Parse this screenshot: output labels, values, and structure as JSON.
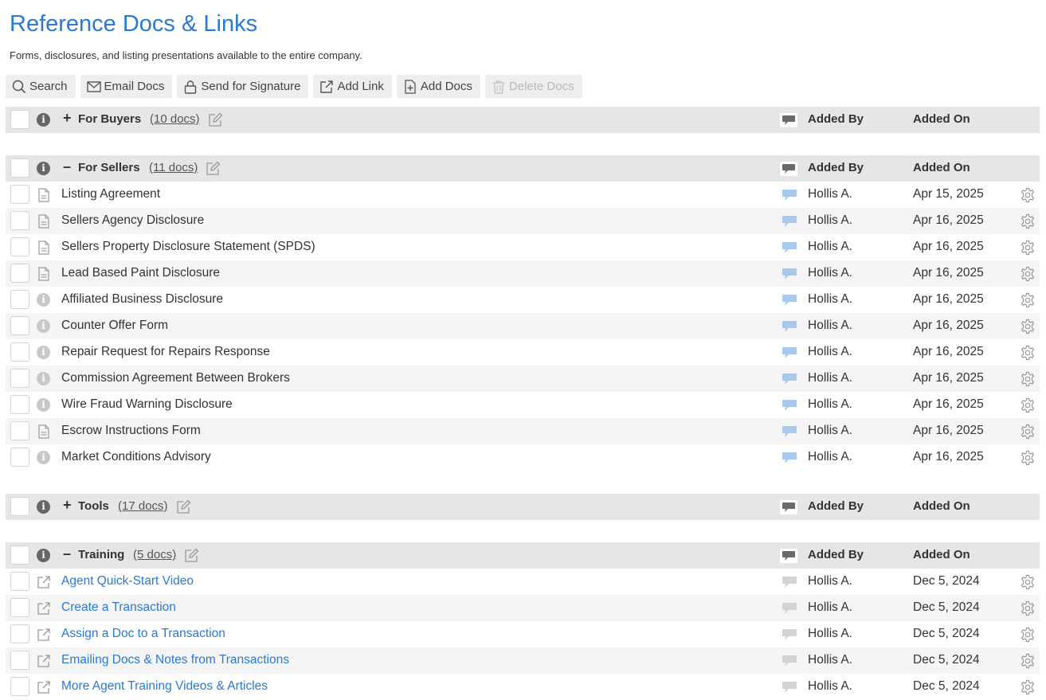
{
  "page": {
    "title": "Reference Docs & Links",
    "subtitle": "Forms, disclosures, and listing presentations available to the entire company."
  },
  "toolbar": {
    "search": "Search",
    "email_docs": "Email Docs",
    "send_for_signature": "Send for Signature",
    "add_link": "Add Link",
    "add_docs": "Add Docs",
    "delete_docs": "Delete Docs"
  },
  "columns": {
    "added_by": "Added By",
    "added_on": "Added On"
  },
  "colors": {
    "accent": "#2a7ad1",
    "comment_active": "#a7c9ec",
    "comment_inactive": "#d3d3d3",
    "header_bg": "#e6e6e6"
  },
  "groups": [
    {
      "toggle": "+",
      "name": "For Buyers",
      "count": "(10 docs)",
      "expanded": false,
      "items": []
    },
    {
      "toggle": "–",
      "name": "For Sellers",
      "count": "(11 docs)",
      "expanded": true,
      "items": [
        {
          "name": "Listing Agreement",
          "icon": "document-icon",
          "added_by": "Hollis A.",
          "added_on": "Apr 15, 2025"
        },
        {
          "name": "Sellers Agency Disclosure",
          "icon": "document-icon",
          "added_by": "Hollis A.",
          "added_on": "Apr 16, 2025"
        },
        {
          "name": "Sellers Property Disclosure Statement (SPDS)",
          "icon": "document-icon",
          "added_by": "Hollis A.",
          "added_on": "Apr 16, 2025"
        },
        {
          "name": "Lead Based Paint Disclosure",
          "icon": "document-icon",
          "added_by": "Hollis A.",
          "added_on": "Apr 16, 2025"
        },
        {
          "name": "Affiliated Business Disclosure",
          "icon": "info-icon",
          "added_by": "Hollis A.",
          "added_on": "Apr 16, 2025"
        },
        {
          "name": "Counter Offer Form",
          "icon": "info-icon",
          "added_by": "Hollis A.",
          "added_on": "Apr 16, 2025"
        },
        {
          "name": "Repair Request for Repairs Response",
          "icon": "info-icon",
          "added_by": "Hollis A.",
          "added_on": "Apr 16, 2025"
        },
        {
          "name": "Commission Agreement Between Brokers",
          "icon": "info-icon",
          "added_by": "Hollis A.",
          "added_on": "Apr 16, 2025"
        },
        {
          "name": "Wire Fraud Warning Disclosure",
          "icon": "info-icon",
          "added_by": "Hollis A.",
          "added_on": "Apr 16, 2025"
        },
        {
          "name": "Escrow Instructions Form",
          "icon": "document-icon",
          "added_by": "Hollis A.",
          "added_on": "Apr 16, 2025"
        },
        {
          "name": "Market Conditions Advisory",
          "icon": "info-icon",
          "added_by": "Hollis A.",
          "added_on": "Apr 16, 2025"
        }
      ]
    },
    {
      "toggle": "+",
      "name": "Tools",
      "count": "(17 docs)",
      "expanded": false,
      "items": []
    },
    {
      "toggle": "–",
      "name": "Training",
      "count": "(5 docs)",
      "expanded": true,
      "items": [
        {
          "name": "Agent Quick-Start Video",
          "icon": "external-link-icon",
          "added_by": "Hollis A.",
          "added_on": "Dec 5, 2024"
        },
        {
          "name": "Create a Transaction",
          "icon": "external-link-icon",
          "added_by": "Hollis A.",
          "added_on": "Dec 5, 2024"
        },
        {
          "name": "Assign a Doc to a Transaction",
          "icon": "external-link-icon",
          "added_by": "Hollis A.",
          "added_on": "Dec 5, 2024"
        },
        {
          "name": "Emailing Docs & Notes from Transactions",
          "icon": "external-link-icon",
          "added_by": "Hollis A.",
          "added_on": "Dec 5, 2024"
        },
        {
          "name": "More Agent Training Videos & Articles",
          "icon": "external-link-icon",
          "added_by": "Hollis A.",
          "added_on": "Dec 5, 2024"
        }
      ]
    }
  ]
}
